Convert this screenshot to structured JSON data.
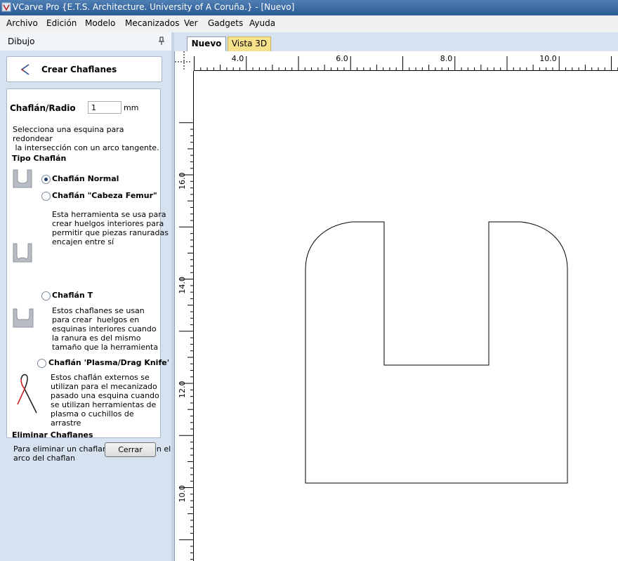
{
  "window": {
    "title": "VCarve Pro {E.T.S. Architecture. University of A Coruña.} - [Nuevo]"
  },
  "menu": [
    "Archivo",
    "Edición",
    "Modelo",
    "Mecanizados",
    "Ver",
    "Gadgets",
    "Ayuda"
  ],
  "panel": {
    "title": "Dibujo",
    "tool_title": "Crear Chaflanes",
    "radius_label": "Chaflán/Radio",
    "radius_value": "1",
    "radius_unit": "mm",
    "instruction": [
      "Selecciona una esquina para",
      "redondear",
      " la intersección con un arco tangente."
    ],
    "type_heading": "Tipo Chaflán",
    "options": [
      {
        "label": "Chaflán Normal",
        "checked": true,
        "description": []
      },
      {
        "label": "Chaflán \"Cabeza Femur\"",
        "checked": false,
        "description": [
          "Esta herramienta se usa para",
          "crear huelgos interiores para",
          "permitir que piezas ranuradas",
          "encajen entre sí"
        ]
      },
      {
        "label": "Chaflán T",
        "checked": false,
        "description": [
          "Estos chaflanes se usan",
          "para crear  huelgos en",
          "esquinas interiores cuando",
          "la ranura es del mismo",
          "tamaño que la herramienta"
        ]
      },
      {
        "label": "Chaflán 'Plasma/Drag Knife'",
        "checked": false,
        "description": [
          "Estos chaflán externos se",
          "utilizan para el mecanizado",
          "pasado una esquina cuando",
          "se utilizan herramientas de",
          "plasma o cuchillos de",
          "arrastre"
        ]
      }
    ],
    "delete_heading": "Eliminar Chaflanes",
    "delete_text": [
      "Para eliminar un chaflan, hacer clic en el",
      "arco del chaflan"
    ],
    "close_label": "Cerrar"
  },
  "tabs": [
    {
      "label": "Nuevo",
      "active": true
    },
    {
      "label": "Vista 3D",
      "active": false
    }
  ],
  "rulers": {
    "horizontal_labels": [
      "4.0",
      "6.0",
      "8.0",
      "10.0"
    ],
    "vertical_labels": [
      "16.0",
      "14.0",
      "12.0",
      "10.0"
    ]
  },
  "colors": {
    "menu_bg": "#f0f0f0",
    "panel_bg": "#d6e2f0",
    "active_tab": "#ffffff",
    "inactive_tab": "#f7e18a"
  }
}
